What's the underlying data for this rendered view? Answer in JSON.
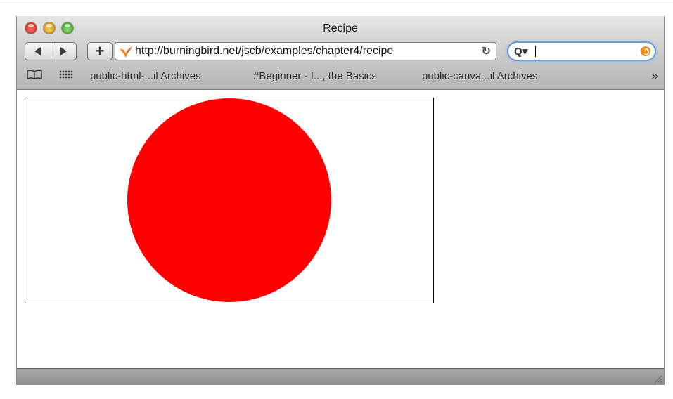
{
  "window": {
    "title": "Recipe"
  },
  "toolbar": {
    "back_icon": "back-arrow-icon",
    "forward_icon": "forward-arrow-icon",
    "add_bookmark_label": "+",
    "url": "http://burningbird.net/jscb/examples/chapter4/recipe",
    "search_value": ""
  },
  "bookmarks": {
    "items": [
      {
        "label": "public-html-...il Archives"
      },
      {
        "label": "#Beginner - I..., the Basics"
      },
      {
        "label": "public-canva...il Archives"
      }
    ],
    "more_label": "»"
  },
  "page": {
    "canvas": {
      "shape": "circle",
      "fill": "#ff0000",
      "background": "#ffffff",
      "border": "#000000"
    }
  }
}
